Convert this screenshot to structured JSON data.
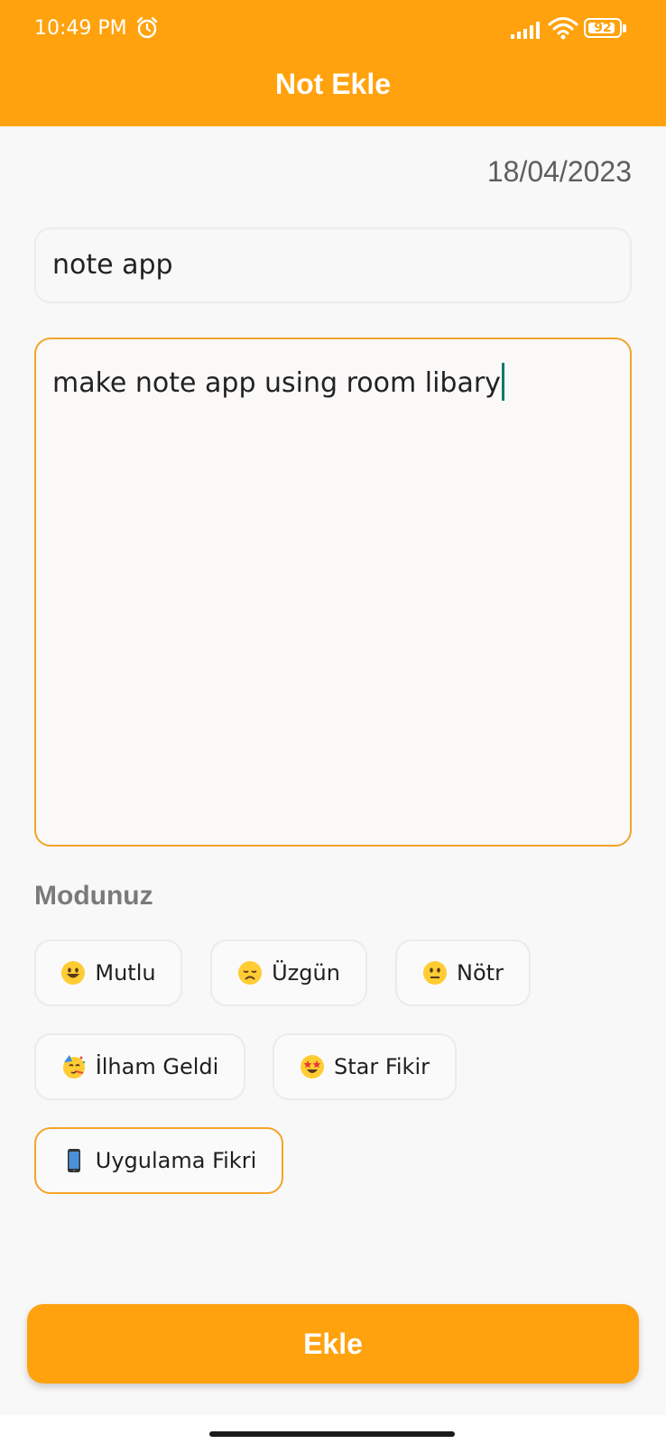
{
  "status_bar": {
    "time": "10:49 PM",
    "battery": "92",
    "battery_level": 0.92,
    "icons": [
      "alarm-icon",
      "signal-icon",
      "wifi-icon",
      "battery-icon"
    ]
  },
  "header": {
    "title": "Not Ekle"
  },
  "form": {
    "date": "18/04/2023",
    "title_value": "note app",
    "body_value": "make note app using room libary"
  },
  "mood": {
    "label": "Modunuz",
    "chips": [
      {
        "label": "Mutlu",
        "emoji": "grinning-face-icon",
        "selected": false
      },
      {
        "label": "Üzgün",
        "emoji": "disappointed-face-icon",
        "selected": false
      },
      {
        "label": "Nötr",
        "emoji": "neutral-face-icon",
        "selected": false
      },
      {
        "label": "İlham Geldi",
        "emoji": "partying-face-icon",
        "selected": false
      },
      {
        "label": "Star Fikir",
        "emoji": "star-struck-face-icon",
        "selected": false
      },
      {
        "label": "Uygulama Fikri",
        "emoji": "mobile-phone-icon",
        "selected": true
      }
    ]
  },
  "actions": {
    "add_label": "Ekle"
  },
  "colors": {
    "accent": "#FFA20D",
    "selected_border": "#F2A428",
    "background": "#F9F8F8"
  }
}
